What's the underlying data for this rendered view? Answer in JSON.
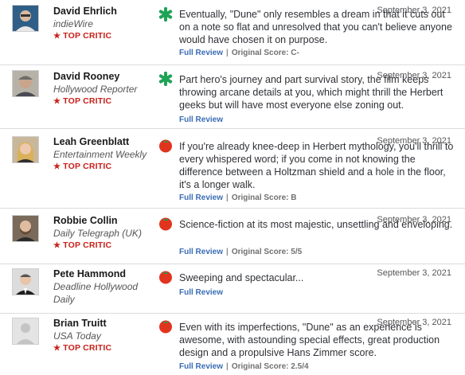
{
  "reviews": [
    {
      "critic": "David Ehrlich",
      "publication": "indieWire",
      "top_critic": "TOP CRITIC",
      "score_icon": "splat-icon",
      "date": "September 3, 2021",
      "quote": "Eventually, \"Dune\" only resembles a dream in that it cuts out on a note so flat and unresolved that you can't believe anyone would have chosen it on purpose.",
      "full_review": "Full Review",
      "original_score": "Original Score: C-"
    },
    {
      "critic": "David Rooney",
      "publication": "Hollywood Reporter",
      "top_critic": "TOP CRITIC",
      "score_icon": "splat-icon",
      "date": "September 3, 2021",
      "quote": "Part hero's journey and part survival story, the film keeps throwing arcane details at you, which might thrill the Herbert geeks but will have most everyone else zoning out.",
      "full_review": "Full Review"
    },
    {
      "critic": "Leah Greenblatt",
      "publication": "Entertainment Weekly",
      "top_critic": "TOP CRITIC",
      "score_icon": "tomato-icon",
      "date": "September 3, 2021",
      "quote": "If you're already knee-deep in Herbert mythology, you'll thrill to every whispered word; if you come in not knowing the difference between a Holtzman shield and a hole in the floor, it's a longer walk.",
      "full_review": "Full Review",
      "original_score": "Original Score: B"
    },
    {
      "critic": "Robbie Collin",
      "publication": "Daily Telegraph (UK)",
      "top_critic": "TOP CRITIC",
      "score_icon": "tomato-icon",
      "date": "September 3, 2021",
      "quote": "Science-fiction at its most majestic, unsettling and enveloping.",
      "full_review": "Full Review",
      "original_score": "Original Score: 5/5"
    },
    {
      "critic": "Pete Hammond",
      "publication": "Deadline Hollywood Daily",
      "score_icon": "tomato-icon",
      "date": "September 3, 2021",
      "quote": "Sweeping and spectacular...",
      "full_review": "Full Review"
    },
    {
      "critic": "Brian Truitt",
      "publication": "USA Today",
      "top_critic": "TOP CRITIC",
      "score_icon": "tomato-icon",
      "date": "September 3, 2021",
      "quote": "Even with its imperfections, \"Dune\" as an experience is awesome, with astounding special effects, great production design and a propulsive Hans Zimmer score.",
      "full_review": "Full Review",
      "original_score": "Original Score: 2.5/4"
    }
  ],
  "colors": {
    "top_critic": "#c8201a",
    "splat_green": "#1fa356",
    "tomato_red": "#e1341e",
    "link_blue": "#3a6db5"
  }
}
